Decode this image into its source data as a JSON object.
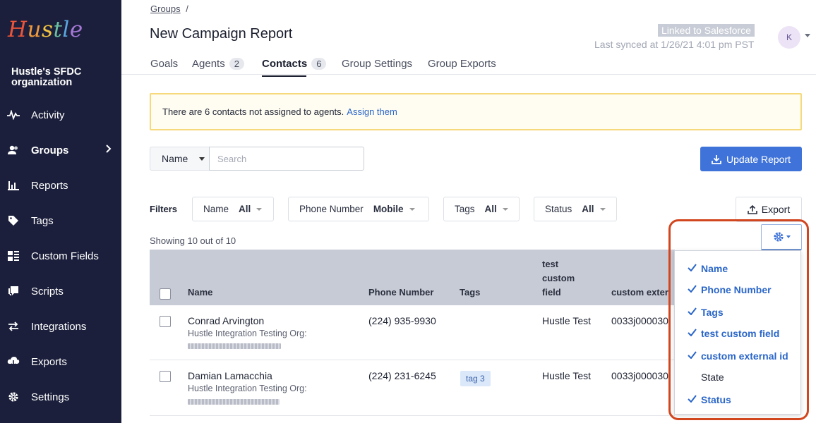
{
  "sidebar": {
    "logo": "Hustle",
    "logo_colors": [
      "#e8553b",
      "#f09a3c",
      "#f4c542",
      "#6cc0a1",
      "#5aa6e0",
      "#a678d6"
    ],
    "org": "Hustle's SFDC organization",
    "items": [
      {
        "label": "Activity",
        "icon": "pulse-icon"
      },
      {
        "label": "Groups",
        "icon": "users-icon",
        "active": true
      },
      {
        "label": "Reports",
        "icon": "bar-chart-icon"
      },
      {
        "label": "Tags",
        "icon": "tag-icon"
      },
      {
        "label": "Custom Fields",
        "icon": "fields-icon"
      },
      {
        "label": "Scripts",
        "icon": "chat-icon"
      },
      {
        "label": "Integrations",
        "icon": "arrows-icon"
      },
      {
        "label": "Exports",
        "icon": "cloud-download-icon"
      },
      {
        "label": "Settings",
        "icon": "gear-icon"
      }
    ]
  },
  "header": {
    "breadcrumb": "Groups",
    "breadcrumb_sep": "/",
    "title": "New Campaign Report",
    "sf_badge": "Linked to Salesforce",
    "last_synced": "Last synced at 1/26/21 4:01 pm PST",
    "avatar": "K"
  },
  "tabs": [
    {
      "label": "Goals"
    },
    {
      "label": "Agents",
      "count": "2"
    },
    {
      "label": "Contacts",
      "count": "6",
      "active": true
    },
    {
      "label": "Group Settings"
    },
    {
      "label": "Group Exports"
    }
  ],
  "alert": {
    "text": "There are 6 contacts not assigned to agents.",
    "link": "Assign them"
  },
  "search": {
    "field": "Name",
    "placeholder": "Search",
    "update_label": "Update Report"
  },
  "filters": {
    "label": "Filters",
    "items": [
      {
        "name": "Name",
        "value": "All"
      },
      {
        "name": "Phone Number",
        "value": "Mobile"
      },
      {
        "name": "Tags",
        "value": "All"
      },
      {
        "name": "Status",
        "value": "All"
      }
    ],
    "export_label": "Export"
  },
  "showing": "Showing 10 out of 10",
  "table": {
    "columns": [
      "Name",
      "Phone Number",
      "Tags",
      "test custom field",
      "custom exter"
    ],
    "col3_lines": [
      "test",
      "custom",
      "field"
    ],
    "rows": [
      {
        "name": "Conrad Arvington",
        "org": "Hustle Integration Testing Org:",
        "phone": "(224) 935-9930",
        "tag": "",
        "custom": "Hustle Test",
        "external": "0033j000030"
      },
      {
        "name": "Damian Lamacchia",
        "org": "Hustle Integration Testing Org:",
        "phone": "(224) 231-6245",
        "tag": "tag 3",
        "custom": "Hustle Test",
        "external": "0033j000030"
      }
    ]
  },
  "column_menu": {
    "icon": "gear-icon",
    "items": [
      {
        "label": "Name",
        "checked": true
      },
      {
        "label": "Phone Number",
        "checked": true
      },
      {
        "label": "Tags",
        "checked": true
      },
      {
        "label": "test custom field",
        "checked": true
      },
      {
        "label": "custom external id",
        "checked": true
      },
      {
        "label": "State",
        "checked": false
      },
      {
        "label": "Status",
        "checked": true
      }
    ]
  },
  "colors": {
    "sidebar_bg": "#1b1f3b",
    "primary": "#3f73d9",
    "link": "#2a66c8",
    "highlight": "#d2461f",
    "alert_border": "#f5d97a"
  }
}
